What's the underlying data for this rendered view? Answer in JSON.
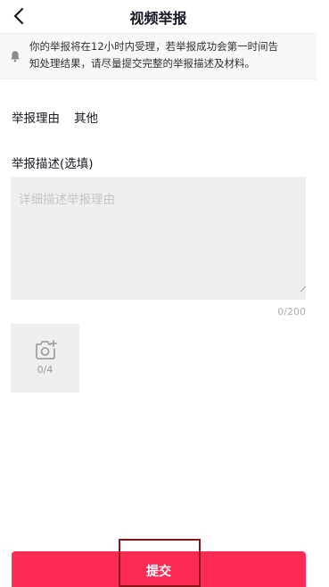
{
  "header": {
    "title": "视频举报",
    "back_icon": "chevron-left-icon"
  },
  "notice": {
    "icon": "bell-icon",
    "line1": "你的举报将在12小时内受理，若举报成功会第一时间告",
    "line2": "知处理结果，请尽量提交完整的举报描述及材料。"
  },
  "reason": {
    "label": "举报理由",
    "value": "其他"
  },
  "description": {
    "label": "举报描述(选填)",
    "placeholder": "详细描述举报理由",
    "value": "",
    "counter": "0/200"
  },
  "upload": {
    "icon": "camera-add-icon",
    "count": "0/4"
  },
  "submit": {
    "label": "提交"
  },
  "colors": {
    "accent": "#fe2c55",
    "highlight_border": "#8b1418",
    "field_bg": "#efefef"
  }
}
